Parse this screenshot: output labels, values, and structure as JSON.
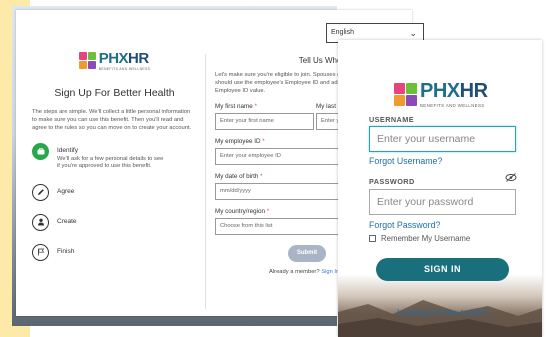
{
  "signup": {
    "language": "English",
    "logo": {
      "text_phx": "PHX",
      "text_hr": "HR",
      "tagline": "BENEFITS AND WELLNESS"
    },
    "title": "Sign Up For Better Health",
    "intro": "The steps are simple. We'll collect a little personal information to make sure you can use this benefit. Then you'll read and agree to the rules so you can move on to create your account.",
    "steps": [
      {
        "name": "Identify",
        "desc": "We'll ask for a few personal details to see if you're approved to use this benefit."
      },
      {
        "name": "Agree",
        "desc": ""
      },
      {
        "name": "Create",
        "desc": ""
      },
      {
        "name": "Finish",
        "desc": ""
      }
    ],
    "form": {
      "heading": "Tell Us Who You Are",
      "text": "Let's make sure you're eligible to join. Spouses enrolled in the medical plan should use the employee's Employee ID and add \"01\" to the end for their Employee ID value.",
      "first_name_label": "My first name",
      "first_name_placeholder": "Enter your first name",
      "last_name_label": "My last name",
      "last_name_placeholder": "Enter your last name",
      "employee_id_label": "My employee ID",
      "employee_id_placeholder": "Enter your employee ID",
      "dob_label": "My date of birth",
      "dob_placeholder": "mm/dd/yyyy",
      "country_label": "My country/region",
      "country_placeholder": "Choose from this list",
      "required_mark": "*",
      "submit": "Submit",
      "member_text": "Already a member?",
      "sign_in_link": "Sign In"
    }
  },
  "login": {
    "logo": {
      "text_phx": "PHX",
      "text_hr": "HR",
      "tagline": "BENEFITS AND WELLNESS"
    },
    "username_label": "USERNAME",
    "username_placeholder": "Enter your username",
    "forgot_username": "Forgot Username?",
    "password_label": "PASSWORD",
    "password_placeholder": "Enter your password",
    "forgot_password": "Forgot Password?",
    "remember_me": "Remember My Username",
    "sign_in": "SIGN IN",
    "join_link": "Looking for how to join?"
  },
  "colors": {
    "accent_teal": "#1a6f7d",
    "link_blue": "#1f6fa8",
    "step_active": "#27a84a",
    "tile_pink": "#e8437e",
    "tile_green": "#6bbf3b",
    "tile_orange": "#f29a2e",
    "tile_purple": "#8a4bb8"
  },
  "icons": {
    "language_select": "chevron-down-icon",
    "steps": [
      "briefcase-icon",
      "pencil-icon",
      "person-icon",
      "flag-icon"
    ],
    "password_toggle": "eye-slash-icon"
  }
}
